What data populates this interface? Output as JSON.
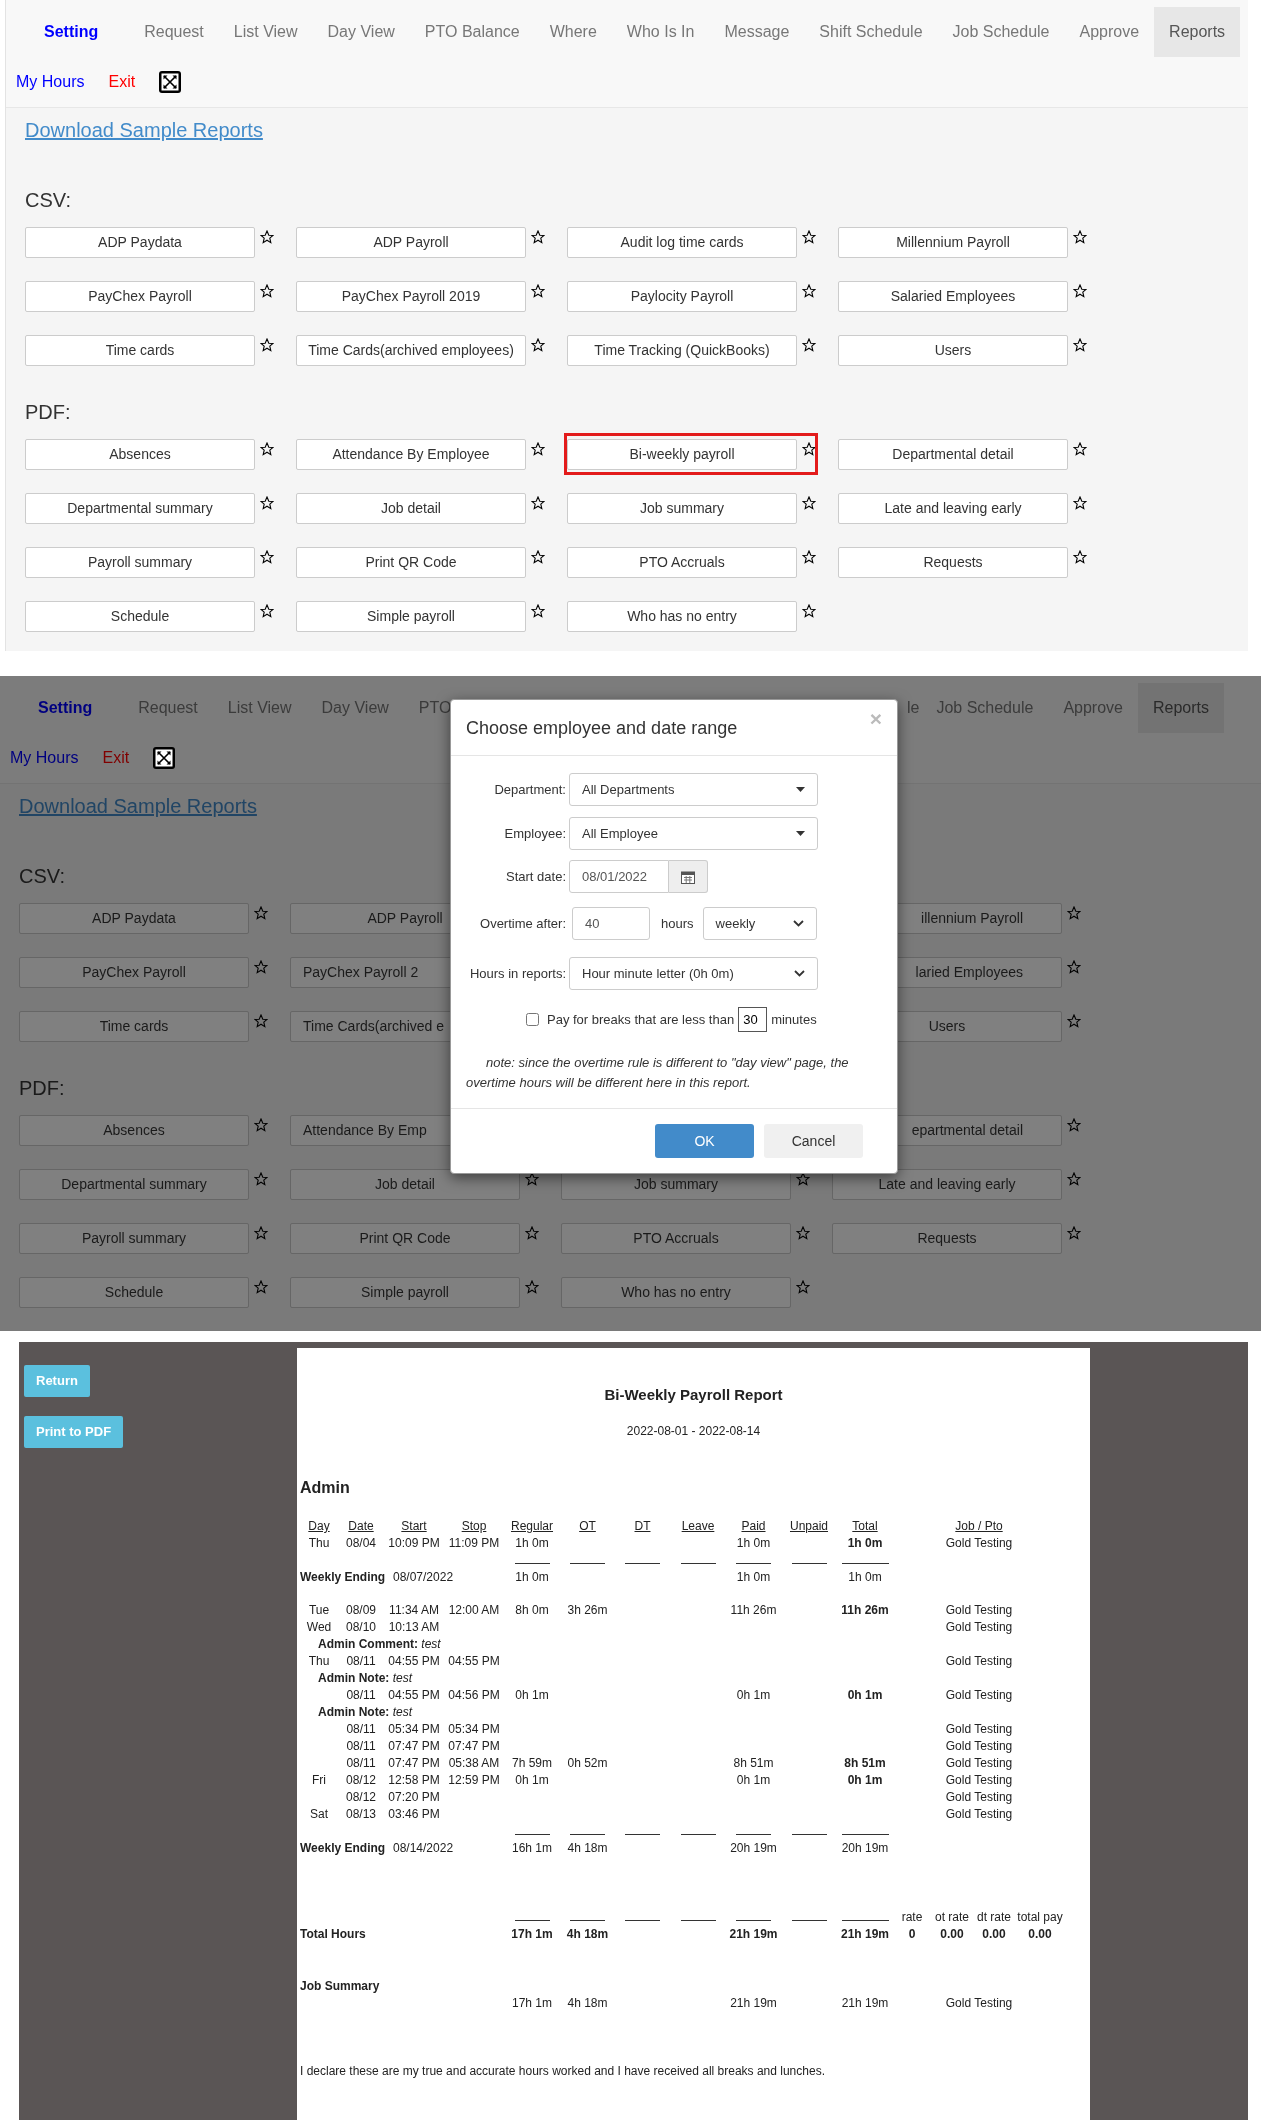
{
  "reports_page": {
    "nav_items": [
      {
        "label": "Setting",
        "kind": "brand",
        "selected": false
      },
      {
        "label": "Request",
        "kind": "link",
        "selected": false
      },
      {
        "label": "List View",
        "kind": "link",
        "selected": false
      },
      {
        "label": "Day View",
        "kind": "link",
        "selected": false
      },
      {
        "label": "PTO Balance",
        "kind": "link",
        "selected": false
      },
      {
        "label": "Where",
        "kind": "link",
        "selected": false
      },
      {
        "label": "Who Is In",
        "kind": "link",
        "selected": false
      },
      {
        "label": "Message",
        "kind": "link",
        "selected": false
      },
      {
        "label": "Shift Schedule",
        "kind": "link",
        "selected": false
      },
      {
        "label": "Job Schedule",
        "kind": "link",
        "selected": false
      },
      {
        "label": "Approve",
        "kind": "link",
        "selected": false
      },
      {
        "label": "Reports",
        "kind": "link",
        "selected": true
      }
    ],
    "links": [
      {
        "label": "My Hours",
        "color": "#0000ff"
      },
      {
        "label": "Exit",
        "color": "#ff0000"
      }
    ],
    "download_link": "Download Sample Reports",
    "sections": [
      {
        "title": "CSV:",
        "reports": [
          {
            "label": "ADP Paydata",
            "highlighted": false
          },
          {
            "label": "ADP Payroll",
            "highlighted": false
          },
          {
            "label": "Audit log time cards",
            "highlighted": false
          },
          {
            "label": "Millennium Payroll",
            "highlighted": false
          },
          {
            "label": "PayChex Payroll",
            "highlighted": false
          },
          {
            "label": "PayChex Payroll 2019",
            "highlighted": false
          },
          {
            "label": "Paylocity Payroll",
            "highlighted": false
          },
          {
            "label": "Salaried Employees",
            "highlighted": false
          },
          {
            "label": "Time cards",
            "highlighted": false
          },
          {
            "label": "Time Cards(archived employees)",
            "highlighted": false
          },
          {
            "label": "Time Tracking (QuickBooks)",
            "highlighted": false
          },
          {
            "label": "Users",
            "highlighted": false
          }
        ]
      },
      {
        "title": "PDF:",
        "reports": [
          {
            "label": "Absences",
            "highlighted": false
          },
          {
            "label": "Attendance By Employee",
            "highlighted": false
          },
          {
            "label": "Bi-weekly payroll",
            "highlighted": true
          },
          {
            "label": "Departmental detail",
            "highlighted": false
          },
          {
            "label": "Departmental summary",
            "highlighted": false
          },
          {
            "label": "Job detail",
            "highlighted": false
          },
          {
            "label": "Job summary",
            "highlighted": false
          },
          {
            "label": "Late and leaving early",
            "highlighted": false
          },
          {
            "label": "Payroll summary",
            "highlighted": false
          },
          {
            "label": "Print QR Code",
            "highlighted": false
          },
          {
            "label": "PTO Accruals",
            "highlighted": false
          },
          {
            "label": "Requests",
            "highlighted": false
          },
          {
            "label": "Schedule",
            "highlighted": false
          },
          {
            "label": "Simple payroll",
            "highlighted": false
          },
          {
            "label": "Who has no entry",
            "highlighted": false
          }
        ]
      }
    ]
  },
  "dialog_page": {
    "background": {
      "nav_items": [
        {
          "label": "Setting",
          "kind": "brand",
          "selected": false
        },
        {
          "label": "Request",
          "kind": "link",
          "selected": false
        },
        {
          "label": "List View",
          "kind": "link",
          "selected": false
        },
        {
          "label": "Day View",
          "kind": "link",
          "selected": false
        },
        {
          "label": "PTO",
          "kind": "cut_right",
          "selected": false
        },
        {
          "label": "le",
          "kind": "cut_left",
          "selected": false
        },
        {
          "label": "Job Schedule",
          "kind": "link",
          "selected": false
        },
        {
          "label": "Approve",
          "kind": "link",
          "selected": false
        },
        {
          "label": "Reports",
          "kind": "link",
          "selected": true
        }
      ],
      "links": [
        {
          "label": "My Hours",
          "color": "#000080"
        },
        {
          "label": "Exit",
          "color": "#800000"
        }
      ],
      "download_link": "Download Sample Reports",
      "sections": [
        {
          "title": "CSV:",
          "reports": [
            {
              "label": "ADP Paydata",
              "kind": "button"
            },
            {
              "label": "ADP Payroll",
              "kind": "no_star"
            },
            {
              "kind": "covered"
            },
            {
              "label": "illennium Payroll",
              "kind": "cut_left"
            },
            {
              "label": "PayChex Payroll",
              "kind": "button"
            },
            {
              "label": "PayChex Payroll 2",
              "kind": "cut_right"
            },
            {
              "kind": "covered"
            },
            {
              "label": "laried Employees",
              "kind": "cut_left"
            },
            {
              "label": "Time cards",
              "kind": "button"
            },
            {
              "label": "Time Cards(archived e",
              "kind": "cut_right"
            },
            {
              "kind": "covered"
            },
            {
              "label": "Users",
              "kind": "button"
            }
          ]
        },
        {
          "title": "PDF:",
          "reports": [
            {
              "label": "Absences",
              "kind": "button"
            },
            {
              "label": "Attendance By Emp",
              "kind": "cut_right"
            },
            {
              "kind": "covered"
            },
            {
              "label": "epartmental detail",
              "kind": "cut_left"
            },
            {
              "label": "Departmental summary",
              "kind": "button"
            },
            {
              "label": "Job detail",
              "kind": "button"
            },
            {
              "label": "Job summary",
              "kind": "button"
            },
            {
              "label": "Late and leaving early",
              "kind": "button"
            },
            {
              "label": "Payroll summary",
              "kind": "button"
            },
            {
              "label": "Print QR Code",
              "kind": "button"
            },
            {
              "label": "PTO Accruals",
              "kind": "button"
            },
            {
              "label": "Requests",
              "kind": "button"
            },
            {
              "label": "Schedule",
              "kind": "button"
            },
            {
              "label": "Simple payroll",
              "kind": "button"
            },
            {
              "label": "Who has no entry",
              "kind": "button"
            }
          ]
        }
      ]
    },
    "dialog": {
      "title": "Choose employee and date range",
      "close": "×",
      "fields": [
        {
          "kind": "select",
          "label": "Department:",
          "value": "All Departments"
        },
        {
          "kind": "select",
          "label": "Employee:",
          "value": "All Employee"
        },
        {
          "kind": "date",
          "label": "Start date:",
          "value": "08/01/2022"
        },
        {
          "kind": "overtime",
          "label": "Overtime after:",
          "value": "40",
          "unit": "hours",
          "period": "weekly"
        },
        {
          "kind": "native_select",
          "label": "Hours in reports:",
          "value": "Hour minute letter (0h 0m)"
        }
      ],
      "break_option": {
        "checked": false,
        "label": "Pay for breaks that are less than",
        "value": "30",
        "unit": "minutes"
      },
      "note": "note: since the overtime rule is different to \"day view\" page, the overtime hours will be different here in this report.",
      "buttons": [
        {
          "label": "OK",
          "kind": "primary"
        },
        {
          "label": "Cancel",
          "kind": "default"
        }
      ]
    }
  },
  "report_view": {
    "buttons": [
      "Return",
      "Print to PDF"
    ],
    "title": "Bi-Weekly Payroll Report",
    "date_range": "2022-08-01 - 2022-08-14",
    "employee": "Admin",
    "columns": [
      "Day",
      "Date",
      "Start",
      "Stop",
      "Regular",
      "OT",
      "DT",
      "Leave",
      "Paid",
      "Unpaid",
      "Total",
      "Job / Pto"
    ],
    "rows": [
      {
        "kind": "entry",
        "day": "Thu",
        "date": "08/04",
        "start": "10:09 PM",
        "stop": "11:09 PM",
        "regular": "1h 0m",
        "paid": "1h 0m",
        "total": "1h 0m",
        "job": "Gold Testing"
      },
      {
        "kind": "rule"
      },
      {
        "kind": "weekly",
        "label": "Weekly Ending",
        "date": "08/07/2022",
        "regular": "1h 0m",
        "paid": "1h 0m",
        "total": "1h 0m"
      },
      {
        "kind": "entry",
        "day": "Tue",
        "date": "08/09",
        "start": "11:34 AM",
        "stop": "12:00 AM",
        "regular": "8h 0m",
        "ot": "3h 26m",
        "paid": "11h 26m",
        "total": "11h 26m",
        "job": "Gold Testing"
      },
      {
        "kind": "entry",
        "day": "Wed",
        "date": "08/10",
        "start": "10:13 AM",
        "job": "Gold Testing"
      },
      {
        "kind": "note",
        "text": "**Admin Comment:** *test*"
      },
      {
        "kind": "entry",
        "day": "Thu",
        "date": "08/11",
        "start": "04:55 PM",
        "stop": "04:55 PM",
        "job": "Gold Testing"
      },
      {
        "kind": "note",
        "text": "**Admin Note:** *test*"
      },
      {
        "kind": "entry",
        "date": "08/11",
        "start": "04:55 PM",
        "stop": "04:56 PM",
        "regular": "0h 1m",
        "paid": "0h 1m",
        "total": "0h 1m",
        "job": "Gold Testing"
      },
      {
        "kind": "note",
        "text": "**Admin Note:** *test*"
      },
      {
        "kind": "entry",
        "date": "08/11",
        "start": "05:34 PM",
        "stop": "05:34 PM",
        "job": "Gold Testing"
      },
      {
        "kind": "entry",
        "date": "08/11",
        "start": "07:47 PM",
        "stop": "07:47 PM",
        "job": "Gold Testing"
      },
      {
        "kind": "entry",
        "date": "08/11",
        "start": "07:47 PM",
        "stop": "05:38 AM",
        "regular": "7h 59m",
        "ot": "0h 52m",
        "paid": "8h 51m",
        "total": "8h 51m",
        "job": "Gold Testing"
      },
      {
        "kind": "entry",
        "day": "Fri",
        "date": "08/12",
        "start": "12:58 PM",
        "stop": "12:59 PM",
        "regular": "0h 1m",
        "paid": "0h 1m",
        "total": "0h 1m",
        "job": "Gold Testing"
      },
      {
        "kind": "entry",
        "date": "08/12",
        "start": "07:20 PM",
        "job": "Gold Testing"
      },
      {
        "kind": "entry",
        "day": "Sat",
        "date": "08/13",
        "start": "03:46 PM",
        "job": "Gold Testing"
      },
      {
        "kind": "rule"
      },
      {
        "kind": "weekly",
        "label": "Weekly Ending",
        "date": "08/14/2022",
        "regular": "16h 1m",
        "ot": "4h 18m",
        "paid": "20h 19m",
        "total": "20h 19m"
      },
      {
        "kind": "rate_header",
        "labels": [
          "rate",
          "ot rate",
          "dt rate",
          "total pay"
        ]
      },
      {
        "kind": "totals",
        "label": "Total Hours",
        "regular": "17h 1m",
        "ot": "4h 18m",
        "paid": "21h 19m",
        "total": "21h 19m",
        "rates": [
          "0",
          "0.00",
          "0.00",
          "0.00"
        ]
      },
      {
        "kind": "section_label",
        "label": "Job Summary"
      },
      {
        "kind": "summary",
        "regular": "17h 1m",
        "ot": "4h 18m",
        "paid": "21h 19m",
        "total": "21h 19m",
        "job": "Gold Testing"
      }
    ],
    "declaration": "I declare these are my true and accurate hours worked and I have received all breaks and lunches."
  }
}
